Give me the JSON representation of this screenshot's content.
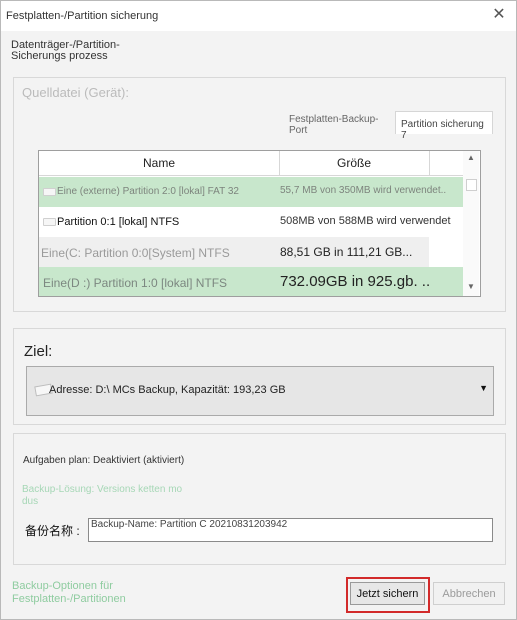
{
  "window": {
    "title": "Festplatten-/Partition sicherung"
  },
  "header": {
    "subtitle": "Datenträger-/Partition-Sicherungs prozess"
  },
  "source": {
    "label": "Quelldatei (Gerät):",
    "tabs": [
      {
        "label": "Festplatten-Backup-Port"
      },
      {
        "label": "Partition sicherung 7"
      }
    ],
    "table": {
      "columns": [
        "Name",
        "Größe"
      ],
      "rows": [
        {
          "name": "Eine (externe) Partition 2:0 [lokal] FAT 32",
          "size": "55,7 MB von 350MB wird verwendet.."
        },
        {
          "name": "Partition 0:1 [lokal] NTFS",
          "size": "508MB von 588MB wird verwendet"
        },
        {
          "name": "Eine(C: Partition 0:0[System] NTFS",
          "size": "88,51 GB in 111,21 GB..."
        },
        {
          "name": "Eine(D :) Partition 1:0 [lokal] NTFS",
          "size": "732.09GB in 925.gb. .."
        }
      ]
    }
  },
  "target": {
    "label": "Ziel:",
    "destination": "Adresse: D:\\ MCs Backup, Kapazität: 193,23 GB"
  },
  "options": {
    "schedule": "Aufgaben plan: Deaktiviert (aktiviert)",
    "scheme": "Backup-Lösung: Versions ketten mo dus",
    "name_label": "备份名称 :",
    "name_value": "Backup-Name: Partition C 20210831203942"
  },
  "footer": {
    "backup_options_link": "Backup-Optionen für Festplatten-/Partitionen",
    "start_button": "Jetzt sichern",
    "cancel_button": "Abbrechen"
  },
  "icons": {
    "close": "close-icon",
    "partition": "partition-icon",
    "scroll_up": "scroll-up-icon",
    "scroll_down": "scroll-down-icon",
    "dropdown": "chevron-down-icon"
  },
  "colors": {
    "selected_row": "#c8e7cc",
    "link": "#8fcca0",
    "highlight_border": "#d22a2a"
  }
}
